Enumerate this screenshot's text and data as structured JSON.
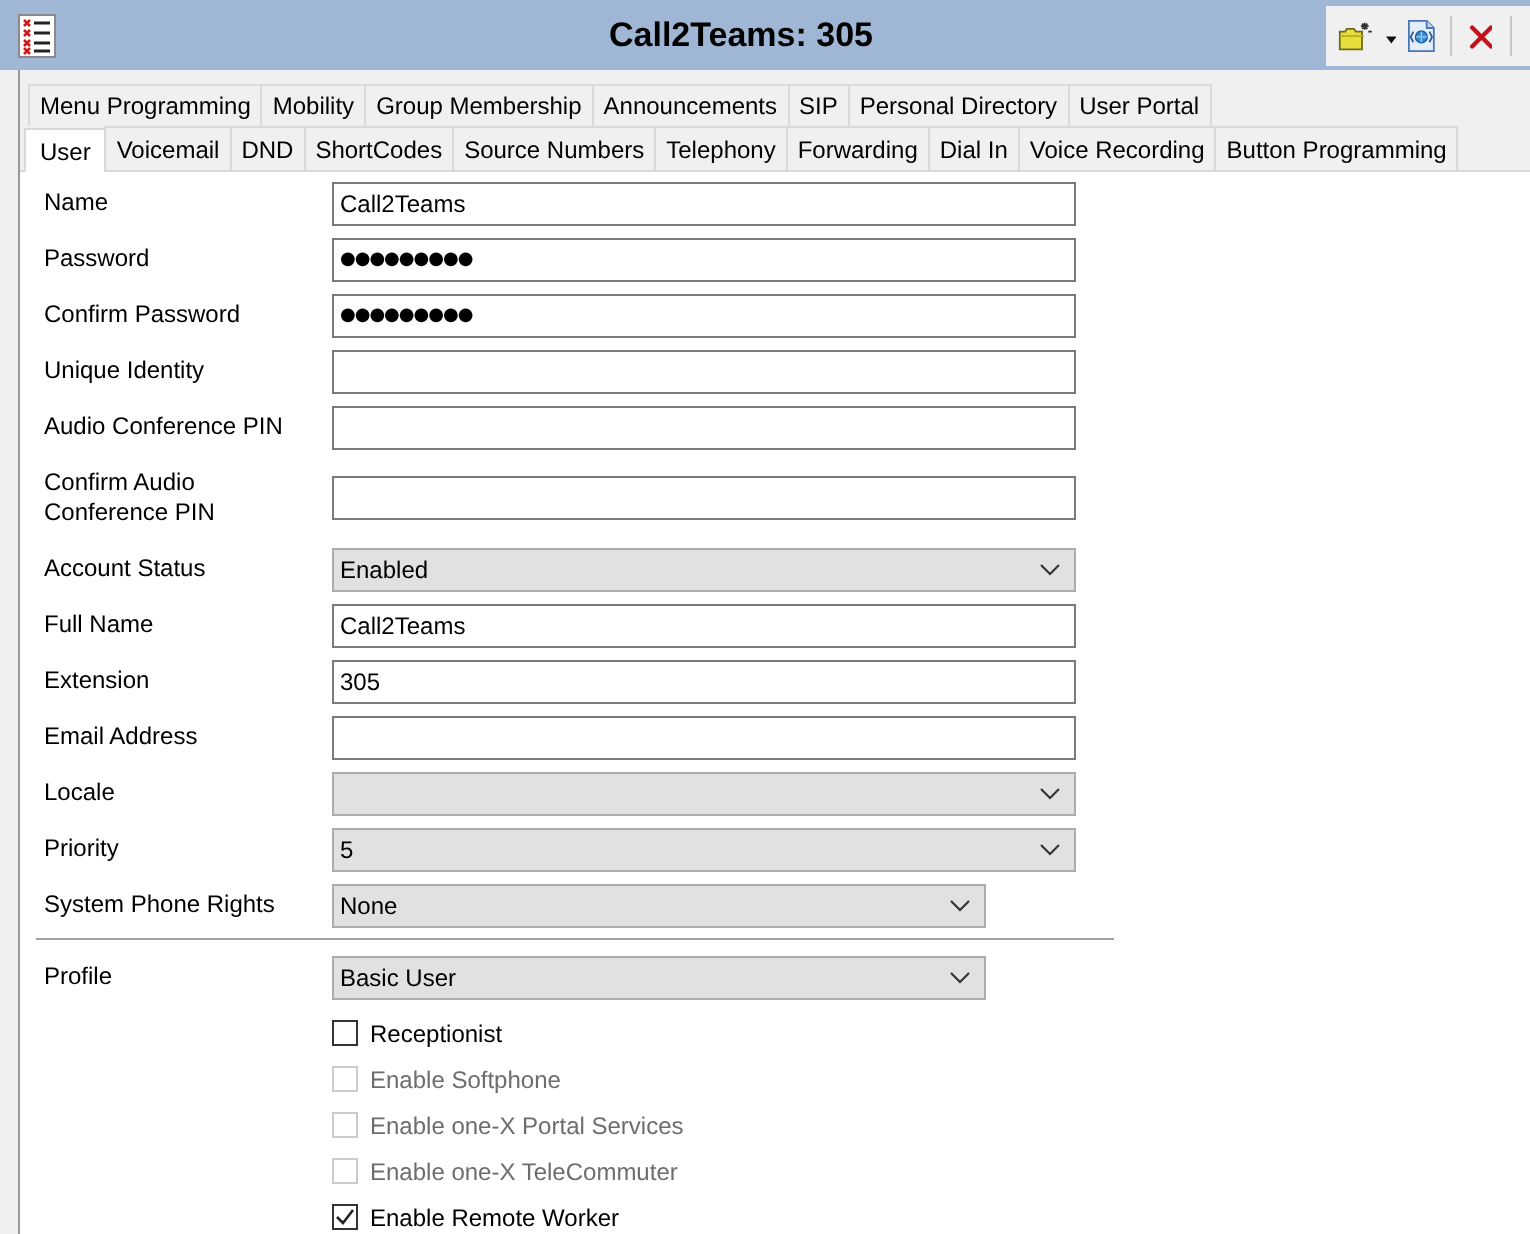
{
  "window": {
    "title": "Call2Teams: 305"
  },
  "tab_rows": [
    {
      "tabs": [
        {
          "label": "Menu Programming",
          "selected": false
        },
        {
          "label": "Mobility",
          "selected": false
        },
        {
          "label": "Group Membership",
          "selected": false
        },
        {
          "label": "Announcements",
          "selected": false
        },
        {
          "label": "SIP",
          "selected": false
        },
        {
          "label": "Personal Directory",
          "selected": false
        },
        {
          "label": "User Portal",
          "selected": false
        }
      ]
    },
    {
      "tabs": [
        {
          "label": "User",
          "selected": true
        },
        {
          "label": "Voicemail",
          "selected": false
        },
        {
          "label": "DND",
          "selected": false
        },
        {
          "label": "ShortCodes",
          "selected": false
        },
        {
          "label": "Source Numbers",
          "selected": false
        },
        {
          "label": "Telephony",
          "selected": false
        },
        {
          "label": "Forwarding",
          "selected": false
        },
        {
          "label": "Dial In",
          "selected": false
        },
        {
          "label": "Voice Recording",
          "selected": false
        },
        {
          "label": "Button Programming",
          "selected": false
        }
      ]
    }
  ],
  "sections": [
    {
      "fields": [
        {
          "label": "Name",
          "kind": "text",
          "value": "Call2Teams"
        },
        {
          "label": "Password",
          "kind": "password",
          "value": "●●●●●●●●●"
        },
        {
          "label": "Confirm Password",
          "kind": "password",
          "value": "●●●●●●●●●"
        },
        {
          "label": "Unique Identity",
          "kind": "text"
        },
        {
          "label": "Audio Conference PIN",
          "kind": "text"
        },
        {
          "label": "Confirm Audio Conference PIN",
          "kind": "text"
        },
        {
          "label": "Account Status",
          "kind": "select",
          "value": "Enabled"
        },
        {
          "label": "Full Name",
          "kind": "text",
          "value": "Call2Teams"
        },
        {
          "label": "Extension",
          "kind": "text",
          "value": "305"
        },
        {
          "label": "Email Address",
          "kind": "text"
        },
        {
          "label": "Locale",
          "kind": "select"
        },
        {
          "label": "Priority",
          "kind": "select",
          "value": "5"
        },
        {
          "label": "System Phone Rights",
          "kind": "select",
          "value": "None"
        }
      ]
    },
    {
      "fields": [
        {
          "label": "Profile",
          "kind": "select",
          "value": "Basic User"
        }
      ],
      "checkboxes": [
        {
          "label": "Receptionist",
          "checked": false,
          "disabled": false
        },
        {
          "label": "Enable Softphone",
          "checked": false,
          "disabled": true
        },
        {
          "label": "Enable one-X Portal Services",
          "checked": false,
          "disabled": true
        },
        {
          "label": "Enable one-X TeleCommuter",
          "checked": false,
          "disabled": true
        },
        {
          "label": "Enable Remote Worker",
          "checked": true,
          "disabled": false
        }
      ]
    }
  ]
}
